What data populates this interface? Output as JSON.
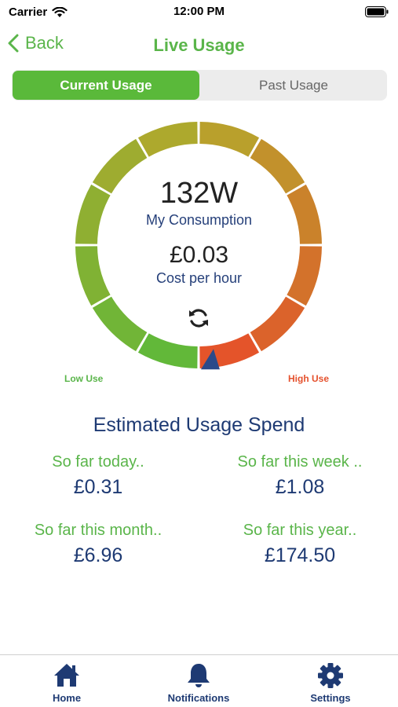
{
  "status_bar": {
    "carrier": "Carrier",
    "time": "12:00 PM"
  },
  "nav": {
    "back_label": "Back",
    "title": "Live Usage"
  },
  "segments": [
    {
      "label": "Current Usage",
      "active": true
    },
    {
      "label": "Past Usage",
      "active": false
    }
  ],
  "gauge": {
    "value": "132W",
    "value_caption": "My Consumption",
    "cost": "£0.03",
    "cost_caption": "Cost per hour",
    "low_label": "Low Use",
    "high_label": "High Use",
    "pointer_level": 0,
    "segment_count": 12,
    "colors": {
      "low": "#5ab93a",
      "mid": "#b5a82c",
      "high": "#e84c2a"
    }
  },
  "spend": {
    "title": "Estimated Usage Spend",
    "items": [
      {
        "label": "So far today..",
        "value": "£0.31"
      },
      {
        "label": "So far this week ..",
        "value": "£1.08"
      },
      {
        "label": "So far this month..",
        "value": "£6.96"
      },
      {
        "label": "So far this year..",
        "value": "£174.50"
      }
    ]
  },
  "tabs": [
    {
      "label": "Home",
      "icon": "home-icon"
    },
    {
      "label": "Notifications",
      "icon": "bell-icon"
    },
    {
      "label": "Settings",
      "icon": "gear-icon"
    }
  ],
  "colors": {
    "accent": "#5ab54a",
    "navy": "#1e3a73",
    "high": "#e5512d"
  }
}
